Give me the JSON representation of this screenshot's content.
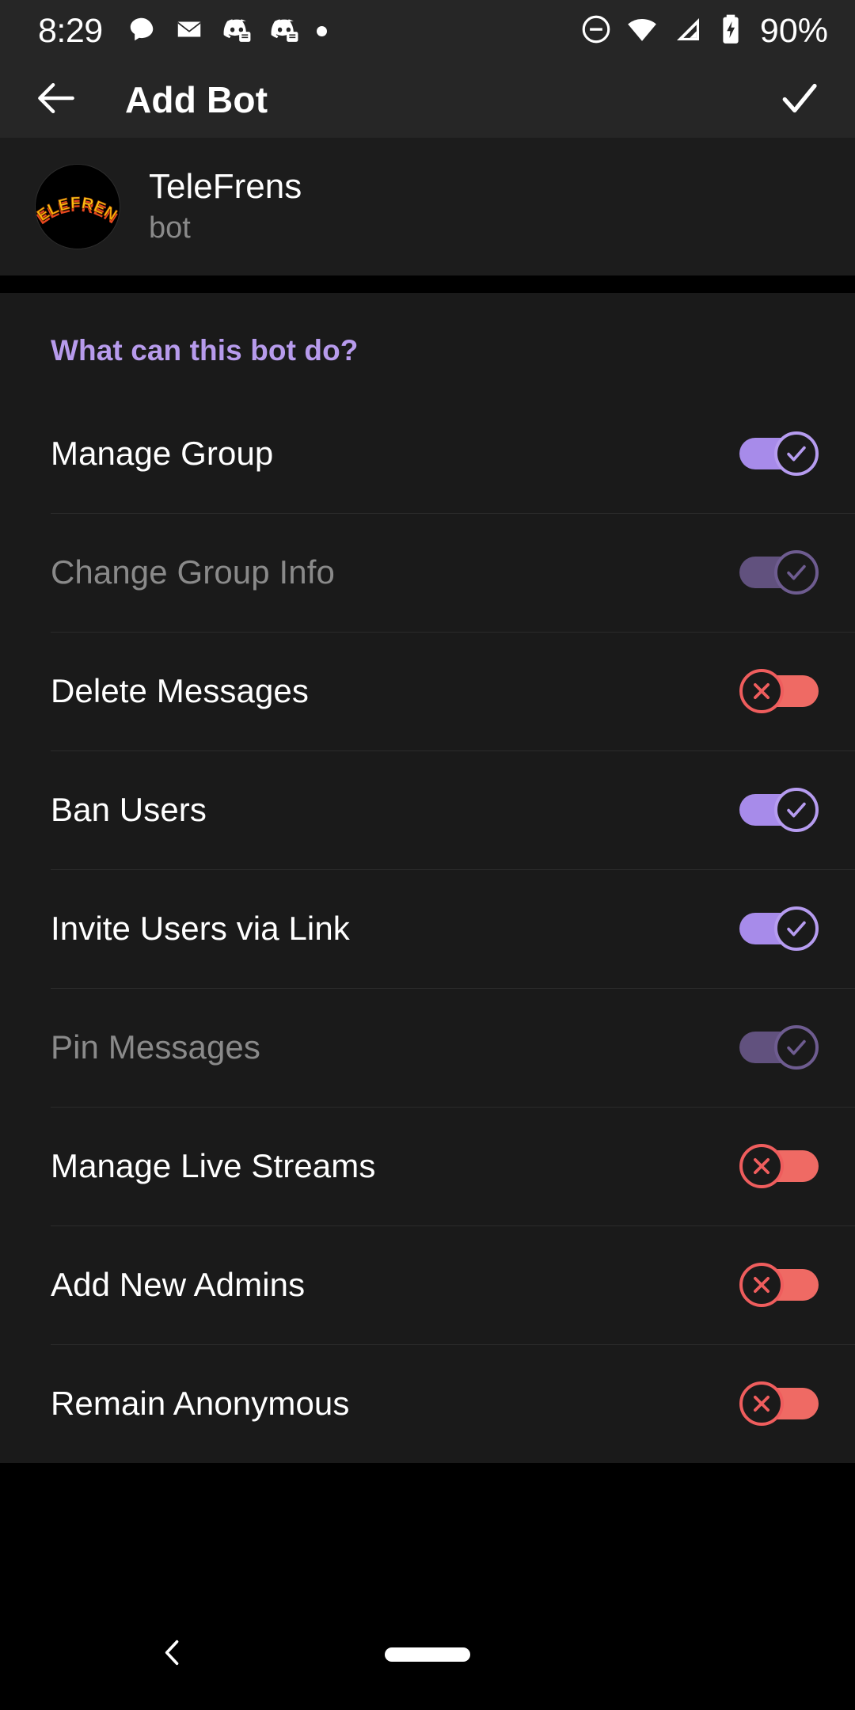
{
  "status_bar": {
    "time": "8:29",
    "battery_percent": "90%",
    "left_icons": [
      "chat-bubble-icon",
      "envelope-icon",
      "discord-icon",
      "discord-icon",
      "dot-indicator-icon"
    ],
    "right_icons": [
      "do-not-disturb-icon",
      "wifi-icon",
      "cellular-signal-icon",
      "battery-charging-icon"
    ]
  },
  "toolbar": {
    "back_icon": "arrow-left-icon",
    "title": "Add Bot",
    "confirm_icon": "check-icon"
  },
  "bot": {
    "name": "TeleFrens",
    "subtitle": "bot",
    "avatar_text": "TELEFRENS",
    "avatar_bg": "#000000",
    "avatar_text_color": "#ffd21e",
    "avatar_text_shadow_color": "#e8481f"
  },
  "section": {
    "header": "What can this bot do?",
    "header_color": "#b79bec"
  },
  "permissions": [
    {
      "label": "Manage Group",
      "state": "on",
      "enabled": true,
      "icon": "check-icon"
    },
    {
      "label": "Change Group Info",
      "state": "on-dim",
      "enabled": false,
      "icon": "check-icon"
    },
    {
      "label": "Delete Messages",
      "state": "off",
      "enabled": true,
      "icon": "cross-icon"
    },
    {
      "label": "Ban Users",
      "state": "on",
      "enabled": true,
      "icon": "check-icon"
    },
    {
      "label": "Invite Users via Link",
      "state": "on",
      "enabled": true,
      "icon": "check-icon"
    },
    {
      "label": "Pin Messages",
      "state": "on-dim",
      "enabled": false,
      "icon": "check-icon"
    },
    {
      "label": "Manage Live Streams",
      "state": "off",
      "enabled": true,
      "icon": "cross-icon"
    },
    {
      "label": "Add New Admins",
      "state": "off",
      "enabled": true,
      "icon": "cross-icon"
    },
    {
      "label": "Remain Anonymous",
      "state": "off",
      "enabled": true,
      "icon": "cross-icon"
    }
  ],
  "colors": {
    "toggle_on": "#a78bea",
    "toggle_on_dim": "#61517e",
    "toggle_off": "#ef6a64",
    "accent": "#b79bec",
    "surface": "#1a1a1a",
    "bar": "#262626"
  },
  "navbar": {
    "back_icon": "nav-back-icon",
    "home_pill": "home-indicator"
  }
}
